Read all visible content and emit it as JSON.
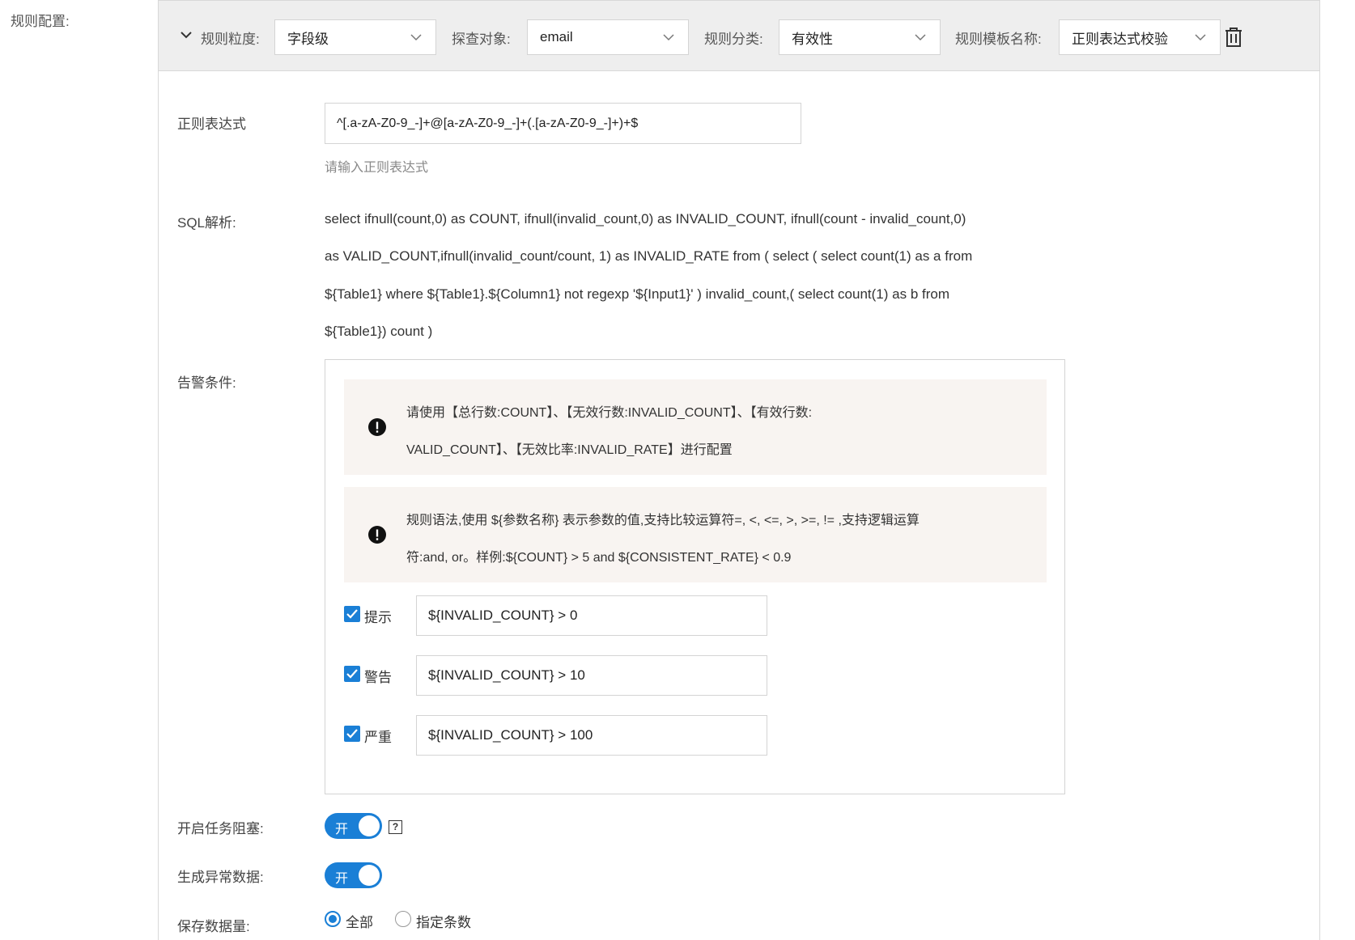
{
  "outer_label": "规则配置:",
  "header": {
    "granularity": {
      "label": "规则粒度:",
      "value": "字段级"
    },
    "target": {
      "label": "探查对象:",
      "value": "email"
    },
    "category": {
      "label": "规则分类:",
      "value": "有效性"
    },
    "template": {
      "label": "规则模板名称:",
      "value": "正则表达式校验"
    }
  },
  "regex": {
    "label": "正则表达式",
    "value": "^[.a-zA-Z0-9_-]+@[a-zA-Z0-9_-]+(.[a-zA-Z0-9_-]+)+$",
    "hint": "请输入正则表达式"
  },
  "sql": {
    "label": "SQL解析:",
    "lines": [
      "select ifnull(count,0) as COUNT, ifnull(invalid_count,0) as INVALID_COUNT, ifnull(count - invalid_count,0)",
      "as VALID_COUNT,ifnull(invalid_count/count, 1) as INVALID_RATE from ( select ( select count(1) as a from",
      "${Table1} where ${Table1}.${Column1} not regexp '${Input1}' ) invalid_count,( select count(1) as b from",
      "${Table1}) count )"
    ]
  },
  "alert": {
    "label": "告警条件:",
    "notices": [
      {
        "line1": "请使用【总行数:COUNT】、【无效行数:INVALID_COUNT】、【有效行数:",
        "line2": "VALID_COUNT】、【无效比率:INVALID_RATE】进行配置"
      },
      {
        "line1": "规则语法,使用 ${参数名称} 表示参数的值,支持比较运算符=, <, <=, >, >=, != ,支持逻辑运算",
        "line2": "符:and, or。样例:${COUNT} > 5 and ${CONSISTENT_RATE} < 0.9"
      }
    ],
    "conditions": [
      {
        "label": "提示",
        "checked": true,
        "value": "${INVALID_COUNT} > 0"
      },
      {
        "label": "警告",
        "checked": true,
        "value": "${INVALID_COUNT} > 10"
      },
      {
        "label": "严重",
        "checked": true,
        "value": "${INVALID_COUNT} > 100"
      }
    ]
  },
  "task_block": {
    "label": "开启任务阻塞:",
    "toggle_text": "开",
    "on": true,
    "help": "?"
  },
  "gen_abnormal": {
    "label": "生成异常数据:",
    "toggle_text": "开",
    "on": true
  },
  "save_amount": {
    "label": "保存数据量:",
    "options": [
      {
        "label": "全部",
        "selected": true
      },
      {
        "label": "指定条数",
        "selected": false
      }
    ]
  },
  "colors": {
    "accent": "#1a7fd6",
    "header_bg": "#eeeeee",
    "notice_bg": "#f8f4f1"
  }
}
